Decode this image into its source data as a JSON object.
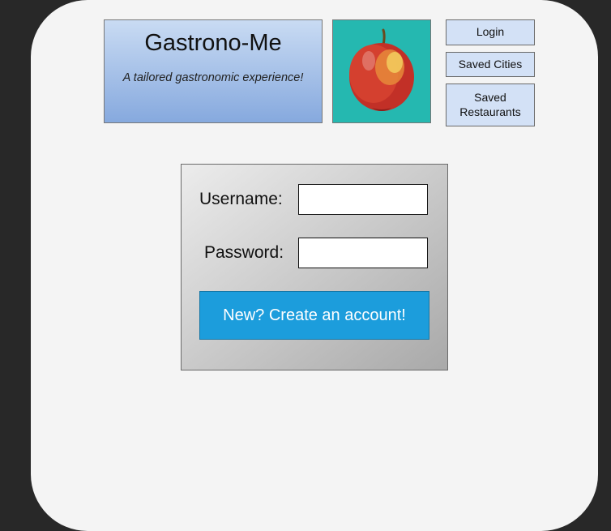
{
  "brand": {
    "title": "Gastrono-Me",
    "tagline": "A tailored gastronomic experience!"
  },
  "nav": {
    "login": "Login",
    "saved_cities": "Saved Cities",
    "saved_restaurants": "Saved\nRestaurants"
  },
  "login_form": {
    "username_label": "Username:",
    "password_label": "Password:",
    "username_value": "",
    "password_value": "",
    "create_account": "New? Create an account!"
  },
  "icons": {
    "apple": "apple-icon"
  }
}
